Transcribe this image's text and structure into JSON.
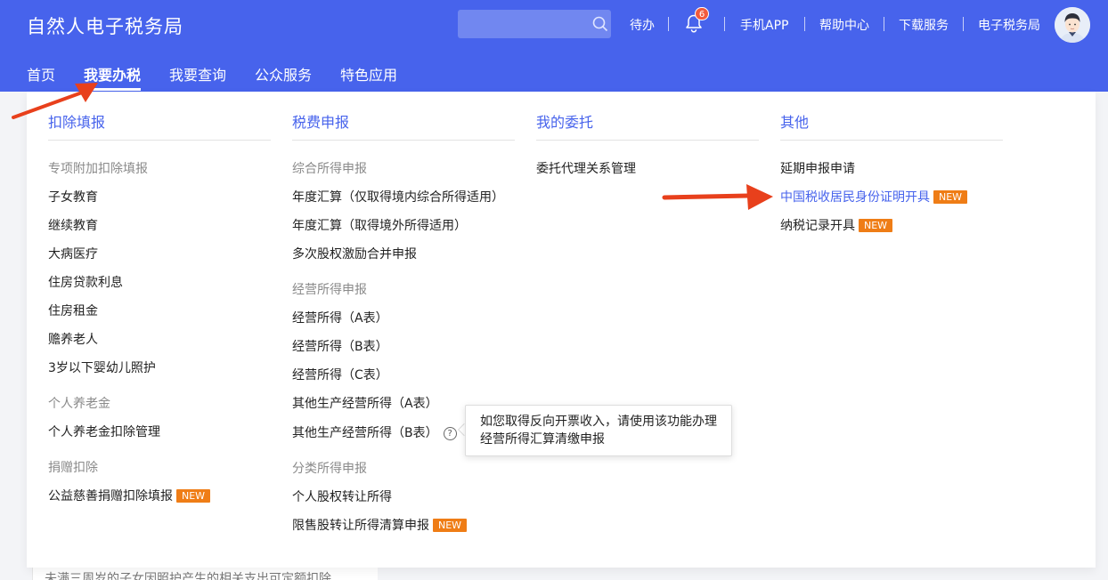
{
  "header": {
    "app_title": "自然人电子税务局",
    "search_placeholder": "",
    "links": {
      "todo": "待办",
      "mobile_app": "手机APP",
      "help_center": "帮助中心",
      "download": "下载服务",
      "etax": "电子税务局"
    },
    "notification_count": "6"
  },
  "nav": {
    "items": [
      "首页",
      "我要办税",
      "我要查询",
      "公众服务",
      "特色应用"
    ],
    "active": "我要办税"
  },
  "menu": {
    "columns": [
      {
        "title": "扣除填报",
        "groups": [
          {
            "label": "专项附加扣除填报",
            "items": [
              "子女教育",
              "继续教育",
              "大病医疗",
              "住房贷款利息",
              "住房租金",
              "赡养老人",
              "3岁以下婴幼儿照护"
            ]
          },
          {
            "label": "个人养老金",
            "items": [
              "个人养老金扣除管理"
            ]
          },
          {
            "label": "捐赠扣除",
            "items": [
              "公益慈善捐赠扣除填报"
            ]
          }
        ]
      },
      {
        "title": "税费申报",
        "groups": [
          {
            "label": "综合所得申报",
            "items": [
              "年度汇算（仅取得境内综合所得适用）",
              "年度汇算（取得境外所得适用）",
              "多次股权激励合并申报"
            ]
          },
          {
            "label": "经营所得申报",
            "items": [
              "经营所得（A表）",
              "经营所得（B表）",
              "经营所得（C表）",
              "其他生产经营所得（A表）",
              "其他生产经营所得（B表）"
            ]
          },
          {
            "label": "分类所得申报",
            "items": [
              "个人股权转让所得",
              "限售股转让所得清算申报"
            ]
          }
        ]
      },
      {
        "title": "我的委托",
        "groups": [
          {
            "label": "",
            "items": [
              "委托代理关系管理"
            ]
          }
        ]
      },
      {
        "title": "其他",
        "groups": [
          {
            "label": "",
            "items": [
              "延期申报申请",
              "中国税收居民身份证明开具",
              "纳税记录开具"
            ]
          }
        ]
      }
    ],
    "new_badge": "NEW",
    "help_mark": "?"
  },
  "tooltip": {
    "line1": "如您取得反向开票收入，请使用该功能办理",
    "line2": "经营所得汇算清缴申报"
  },
  "behind_text": "未满三周岁的子女因照护产生的相关支出可定额扣除",
  "colors": {
    "header_bg": "#4763ec",
    "accent": "#4763ec",
    "new_badge": "#ef7d16",
    "annotation_arrow": "#e8401c"
  }
}
